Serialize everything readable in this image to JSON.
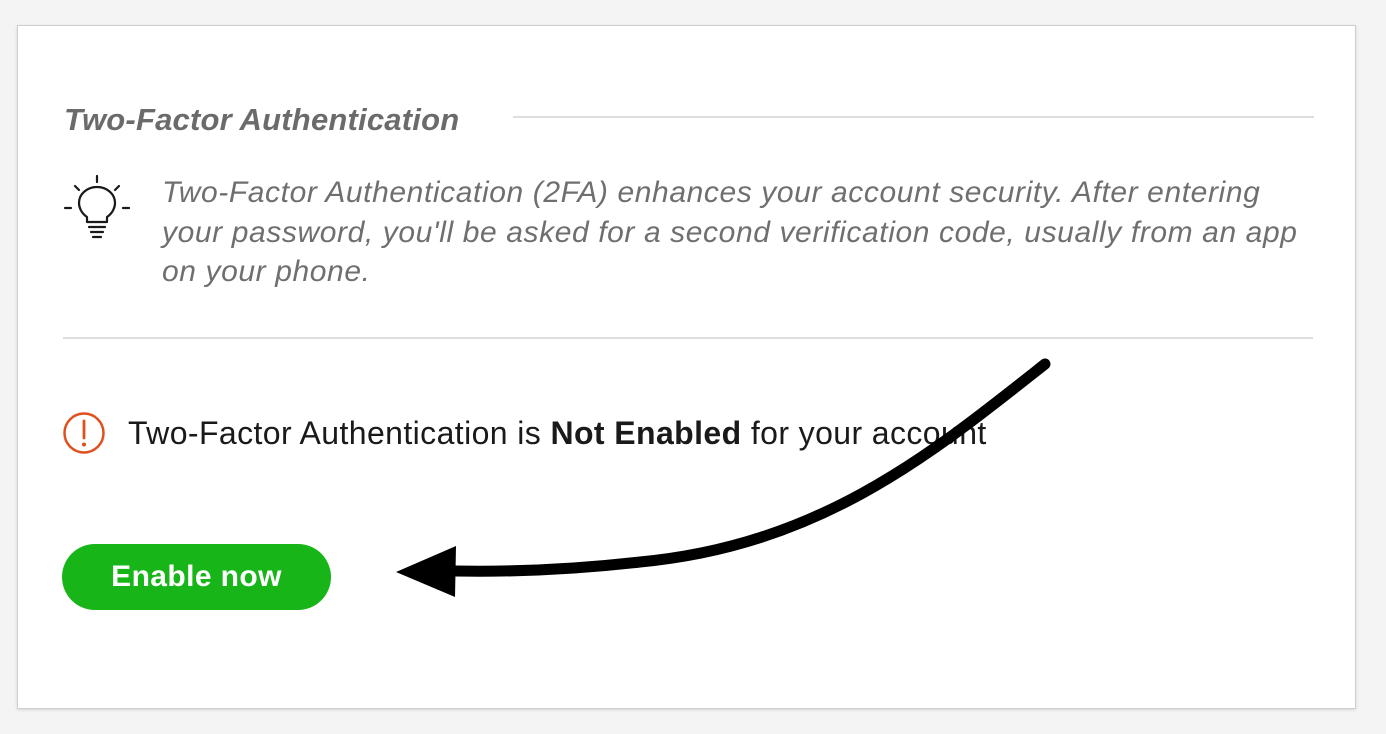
{
  "section": {
    "title": "Two-Factor Authentication"
  },
  "info": {
    "icon": "lightbulb-icon",
    "text": "Two-Factor Authentication (2FA) enhances your account security. After entering your password, you'll be asked for a second verification code, usually from an app on your phone."
  },
  "status": {
    "icon": "alert-circle-icon",
    "prefix": "Two-Factor Authentication is ",
    "emphasis": "Not Enabled",
    "suffix": " for your account"
  },
  "actions": {
    "enable_label": "Enable now"
  },
  "annotation": {
    "icon": "curved-arrow-icon"
  },
  "colors": {
    "accent_green": "#18b518",
    "alert_orange": "#e0501e",
    "title_gray": "#6b6b6b",
    "text_dark": "#1a1a1a"
  }
}
